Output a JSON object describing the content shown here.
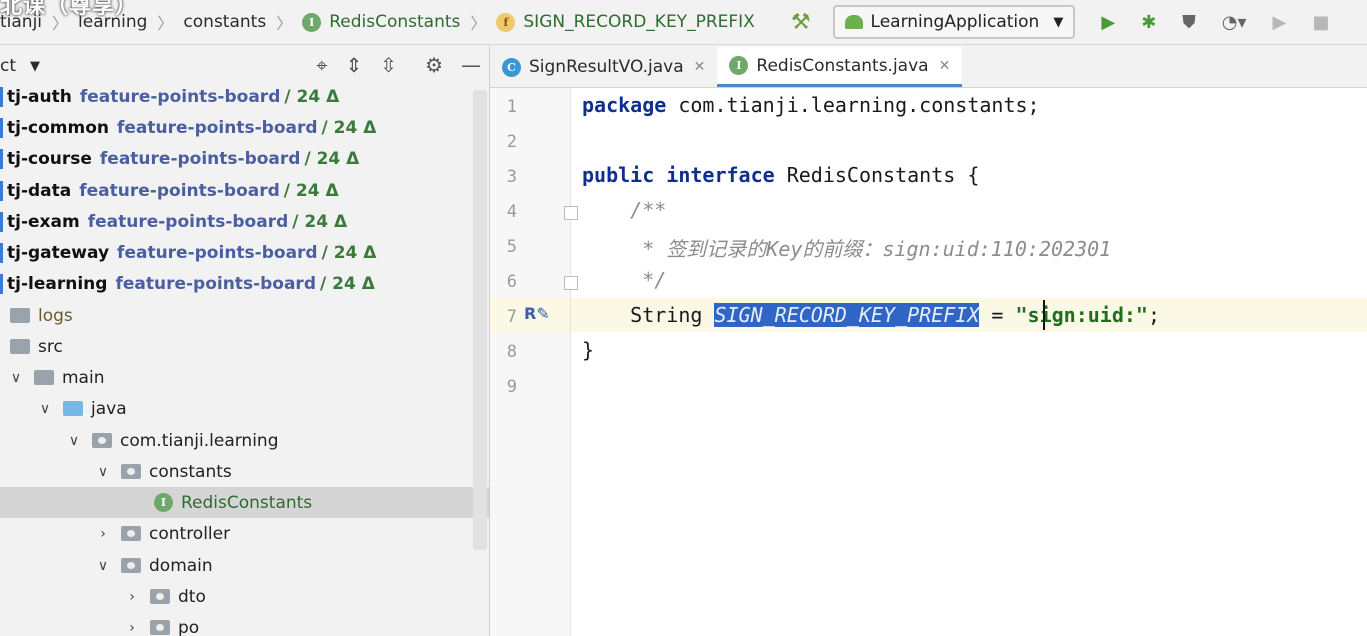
{
  "breadcrumbs": [
    {
      "label": "tianji",
      "type": "text"
    },
    {
      "label": "learning",
      "type": "text"
    },
    {
      "label": "constants",
      "type": "text"
    },
    {
      "label": "RedisConstants",
      "type": "interface"
    },
    {
      "label": "SIGN_RECORD_KEY_PREFIX",
      "type": "field"
    }
  ],
  "watermark": "北课（尊享）",
  "run_config": {
    "label": "LearningApplication"
  },
  "project_panel": {
    "title": "ct",
    "modules": [
      {
        "name": "tj-auth",
        "branch": "feature-points-board",
        "delta": "/ 24 Δ"
      },
      {
        "name": "tj-common",
        "branch": "feature-points-board",
        "delta": "/ 24 Δ"
      },
      {
        "name": "tj-course",
        "branch": "feature-points-board",
        "delta": "/ 24 Δ"
      },
      {
        "name": "tj-data",
        "branch": "feature-points-board",
        "delta": "/ 24 Δ"
      },
      {
        "name": "tj-exam",
        "branch": "feature-points-board",
        "delta": "/ 24 Δ"
      },
      {
        "name": "tj-gateway",
        "branch": "feature-points-board",
        "delta": "/ 24 Δ"
      },
      {
        "name": "tj-learning",
        "branch": "feature-points-board",
        "delta": "/ 24 Δ"
      }
    ],
    "folders": {
      "logs": "logs",
      "src": "src",
      "main": "main",
      "java": "java",
      "package": "com.tianji.learning",
      "constants": "constants",
      "redis": "RedisConstants",
      "controller": "controller",
      "domain": "domain",
      "dto": "dto",
      "po": "po"
    }
  },
  "tabs": [
    {
      "label": "SignResultVO.java",
      "icon": "C"
    },
    {
      "label": "RedisConstants.java",
      "icon": "I"
    }
  ],
  "editor": {
    "line_numbers": [
      "1",
      "2",
      "3",
      "4",
      "5",
      "6",
      "7",
      "8",
      "9"
    ],
    "kw_package": "package",
    "package_name": " com.tianji.learning.constants;",
    "kw_public": "public",
    "kw_interface": "interface",
    "interface_decl": " RedisConstants {",
    "comment_open": "    /**",
    "comment_body": "     * 签到记录的Key的前缀：sign:uid:110:202301",
    "comment_close": "     */",
    "type": "    String ",
    "const_name": "SIGN_RECORD_KEY_PREFIX",
    "assign": " = ",
    "str_value": "\"sign:uid:\"",
    "semicolon": ";",
    "close_brace": "}"
  },
  "icons": [
    "hammer-icon",
    "run-icon",
    "debug-icon",
    "coverage-icon",
    "profile-icon",
    "stop-icon",
    "crosshair-icon",
    "expand-icon",
    "collapse-icon",
    "gear-icon",
    "minimize-icon"
  ],
  "colors": {
    "keyword": "#0f2f8f",
    "string": "#1f6e1f",
    "selection": "#2f65c4",
    "branch": "#4b5fa0"
  }
}
